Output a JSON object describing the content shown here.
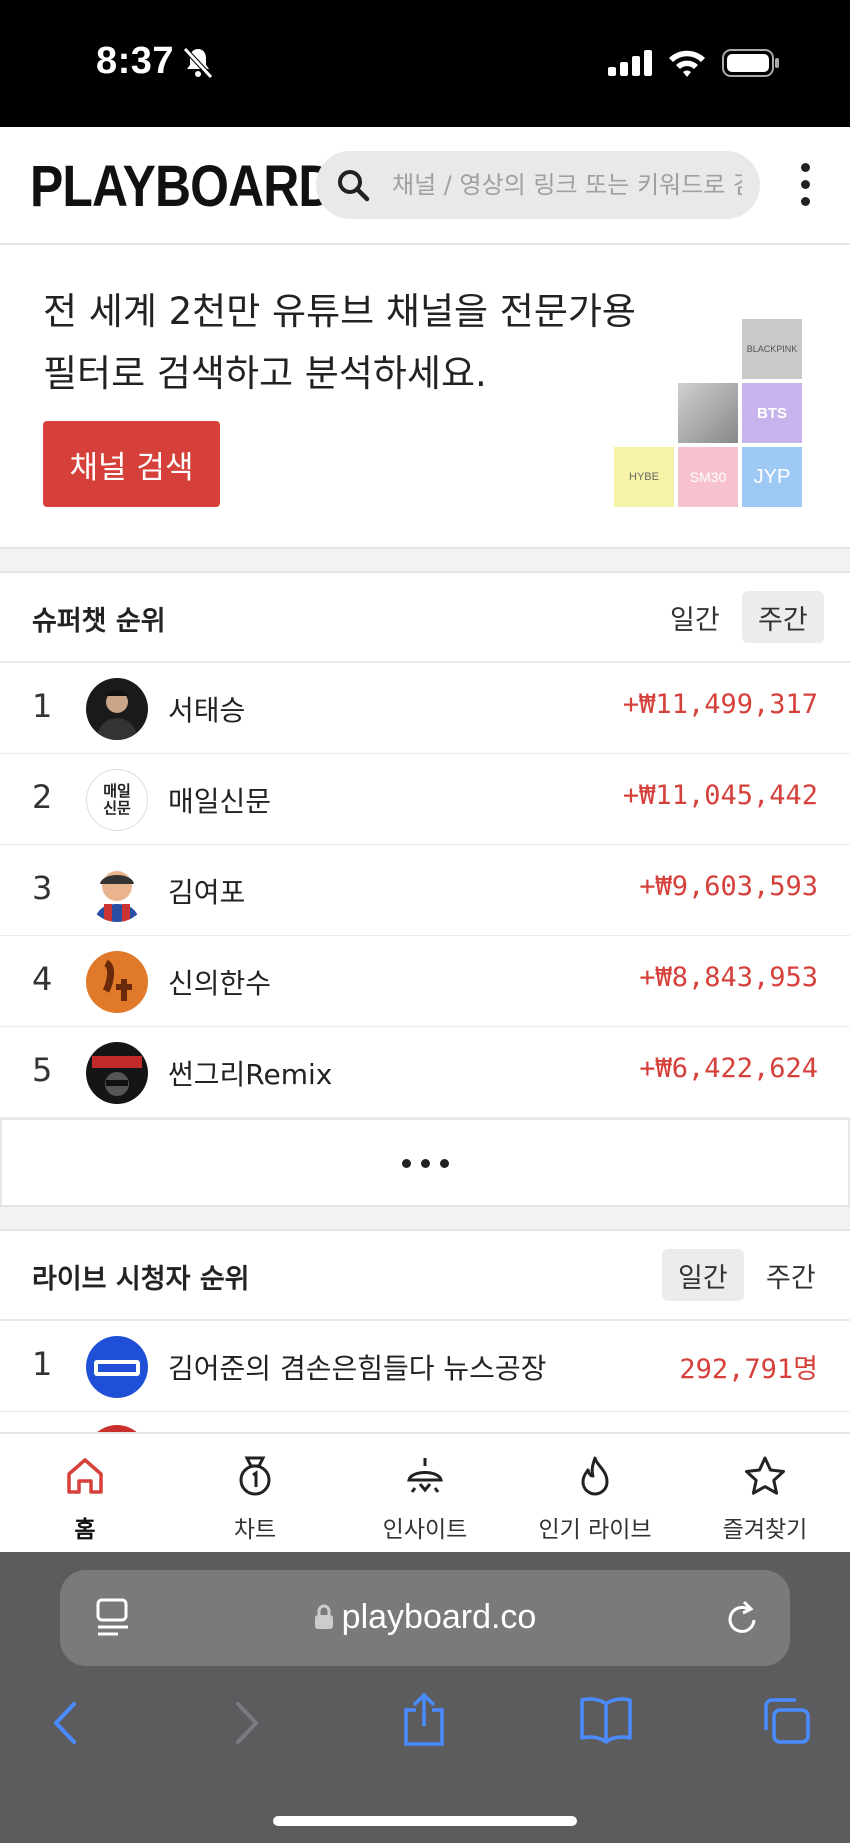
{
  "status_bar": {
    "time": "8:37"
  },
  "header": {
    "logo": "PLAYBOARD",
    "search_placeholder": "채널 / 영상의 링크 또는 키워드로 검색"
  },
  "promo": {
    "line1": "전 세계 2천만 유튜브 채널을 전문가용",
    "line2": "필터로 검색하고 분석하세요.",
    "button_label": "채널 검색",
    "tiles": [
      "BLACKPINK",
      "BTS",
      "HYBE",
      "SM30",
      "JYP"
    ]
  },
  "superchat": {
    "title": "슈퍼챗 순위",
    "toggle_daily": "일간",
    "toggle_weekly": "주간",
    "active_toggle": "주간",
    "rows": [
      {
        "rank": "1",
        "name": "서태승",
        "amount": "+₩11,499,317"
      },
      {
        "rank": "2",
        "name": "매일신문",
        "amount": "+₩11,045,442"
      },
      {
        "rank": "3",
        "name": "김여포",
        "amount": "+₩9,603,593"
      },
      {
        "rank": "4",
        "name": "신의한수",
        "amount": "+₩8,843,953"
      },
      {
        "rank": "5",
        "name": "썬그리Remix",
        "amount": "+₩6,422,624"
      }
    ],
    "avatar_texts": {
      "row2": "매일\n신문"
    }
  },
  "live": {
    "title": "라이브 시청자 순위",
    "toggle_daily": "일간",
    "toggle_weekly": "주간",
    "active_toggle": "일간",
    "rows": [
      {
        "rank": "1",
        "name": "김어준의 겸손은힘들다 뉴스공장",
        "viewers": "292,791명"
      }
    ]
  },
  "bottom_nav": [
    {
      "label": "홈",
      "icon": "home-icon",
      "active": true
    },
    {
      "label": "차트",
      "icon": "medal-icon",
      "active": false
    },
    {
      "label": "인사이트",
      "icon": "lamp-icon",
      "active": false
    },
    {
      "label": "인기 라이브",
      "icon": "fire-icon",
      "active": false
    },
    {
      "label": "즐겨찾기",
      "icon": "star-icon",
      "active": false
    }
  ],
  "browser": {
    "url": "playboard.co"
  },
  "colors": {
    "accent": "#d6403a",
    "amount": "#d6403a",
    "safari_bg": "#5c5c5e",
    "safari_tint": "#4a8cff"
  }
}
